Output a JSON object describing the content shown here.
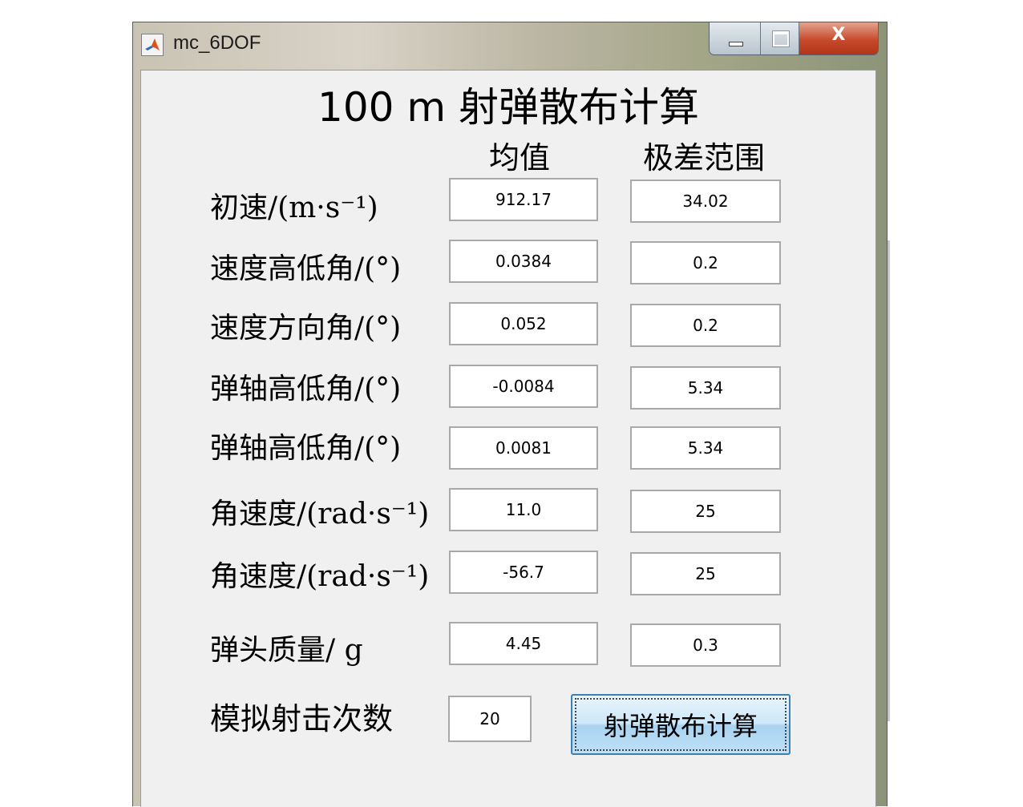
{
  "window": {
    "title": "mc_6DOF",
    "close_glyph": "X"
  },
  "form": {
    "heading": "100 m 射弹散布计算",
    "col_mean": "均值",
    "col_range": "极差范围",
    "rows": [
      {
        "label": "初速/(m·s⁻¹)",
        "mean": "912.17",
        "range": "34.02"
      },
      {
        "label": "速度高低角/(°)",
        "mean": "0.0384",
        "range": "0.2"
      },
      {
        "label": "速度方向角/(°)",
        "mean": "0.052",
        "range": "0.2"
      },
      {
        "label": "弹轴高低角/(°)",
        "mean": "-0.0084",
        "range": "5.34"
      },
      {
        "label": "弹轴高低角/(°)",
        "mean": "0.0081",
        "range": "5.34"
      },
      {
        "label": "角速度/(rad·s⁻¹)",
        "mean": "11.0",
        "range": "25"
      },
      {
        "label": "角速度/(rad·s⁻¹)",
        "mean": "-56.7",
        "range": "25"
      },
      {
        "label": "弹头质量/ g",
        "mean": "4.45",
        "range": "0.3"
      }
    ],
    "sim_label": "模拟射击次数",
    "sim_count": "20",
    "run_button": "射弹散布计算"
  },
  "icons": {
    "app": "matlab-logo-icon",
    "minimize": "minimize-icon",
    "maximize": "maximize-icon",
    "close": "close-icon"
  }
}
